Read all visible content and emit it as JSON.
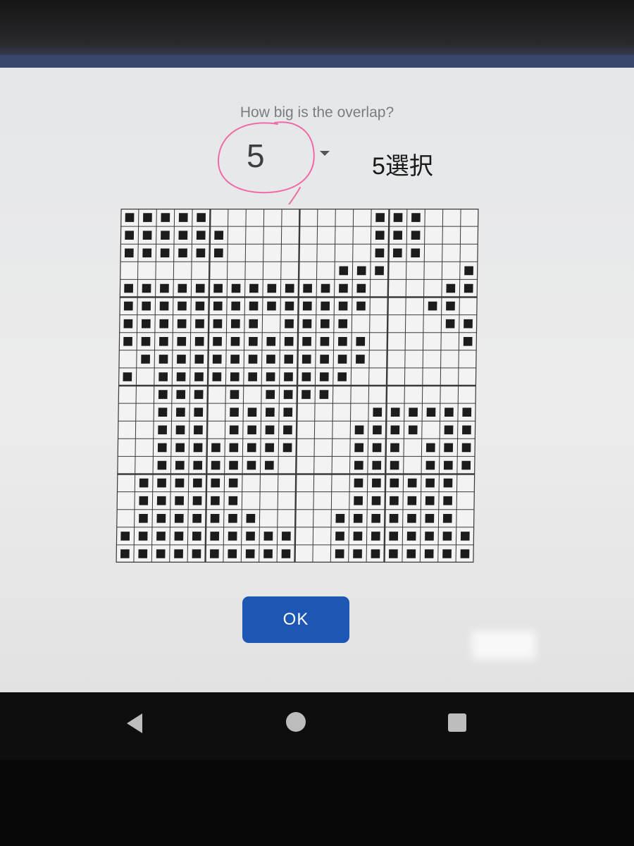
{
  "dialog": {
    "question": "How big is the overlap?",
    "selected_value": "5",
    "ok_label": "OK"
  },
  "annotation": {
    "text": "5選択",
    "circle_color": "#f06aa8"
  },
  "colors": {
    "accent": "#1e57b3",
    "mark": "#1c1c1c",
    "grid_line": "#3a3a3a",
    "cell_bg": "#f3f3f3"
  },
  "pattern": {
    "cols": 20,
    "rows": 20,
    "rows_data": [
      "11111000000000111000",
      "11111100000000111000",
      "11111100000000111000",
      "00000000000011100001",
      "11111111111111000011",
      "11111111111111000110",
      "11111111011110000011",
      "11111111111111000001",
      "01111111111111000000",
      "10111111111110000000",
      "00111010111100000000",
      "00111011110000111111",
      "00111011110001111011",
      "00111111110001110111",
      "00111111100001110111",
      "01111110000001111110",
      "01111110000001111110",
      "01111111000011111110",
      "11111111110011111111",
      "11111111110011111111"
    ]
  },
  "nav": {
    "back_icon": "back-triangle-icon",
    "home_icon": "home-circle-icon",
    "recent_icon": "recent-square-icon"
  }
}
